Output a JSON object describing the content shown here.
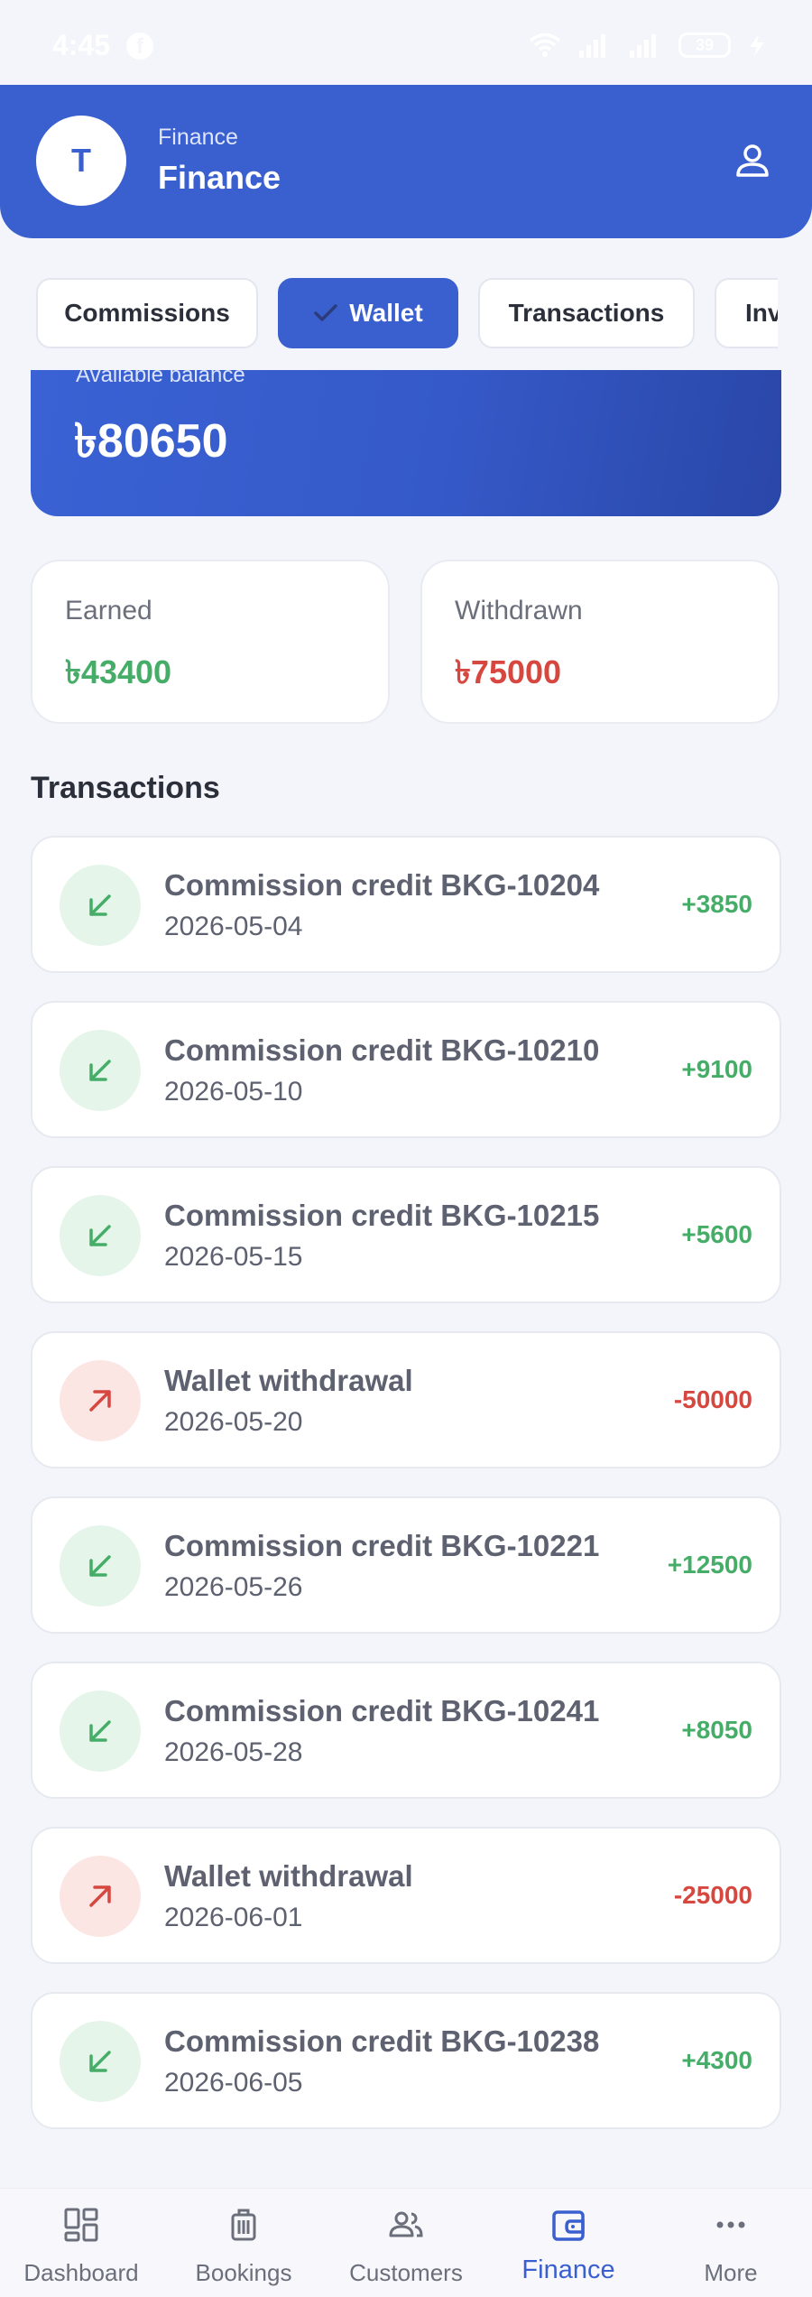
{
  "status_bar": {
    "time": "4:45",
    "battery": "39"
  },
  "header": {
    "avatar_letter": "T",
    "subtitle": "Finance",
    "title": "Finance"
  },
  "tabs": [
    {
      "label": "Commissions"
    },
    {
      "label": "Wallet",
      "active": true
    },
    {
      "label": "Transactions"
    },
    {
      "label": "Inv"
    }
  ],
  "balance": {
    "label": "Available balance",
    "value": "৳80650"
  },
  "stats": {
    "earned": {
      "label": "Earned",
      "value": "৳43400"
    },
    "withdrawn": {
      "label": "Withdrawn",
      "value": "৳75000"
    }
  },
  "transactions_title": "Transactions",
  "transactions": [
    {
      "title": "Commission credit BKG-10204",
      "date": "2026-05-04",
      "amount": "+3850",
      "direction": "in",
      "icon": "arrow-down-left-icon"
    },
    {
      "title": "Commission credit BKG-10210",
      "date": "2026-05-10",
      "amount": "+9100",
      "direction": "in",
      "icon": "arrow-down-left-icon"
    },
    {
      "title": "Commission credit BKG-10215",
      "date": "2026-05-15",
      "amount": "+5600",
      "direction": "in",
      "icon": "arrow-down-left-icon"
    },
    {
      "title": "Wallet withdrawal",
      "date": "2026-05-20",
      "amount": "-50000",
      "direction": "out",
      "icon": "arrow-up-right-icon"
    },
    {
      "title": "Commission credit BKG-10221",
      "date": "2026-05-26",
      "amount": "+12500",
      "direction": "in",
      "icon": "arrow-down-left-icon"
    },
    {
      "title": "Commission credit BKG-10241",
      "date": "2026-05-28",
      "amount": "+8050",
      "direction": "in",
      "icon": "arrow-down-left-icon"
    },
    {
      "title": "Wallet withdrawal",
      "date": "2026-06-01",
      "amount": "-25000",
      "direction": "out",
      "icon": "arrow-up-right-icon"
    },
    {
      "title": "Commission credit BKG-10238",
      "date": "2026-06-05",
      "amount": "+4300",
      "direction": "in",
      "icon": "arrow-down-left-icon"
    }
  ],
  "bottom_nav": [
    {
      "label": "Dashboard",
      "icon": "dashboard-icon"
    },
    {
      "label": "Bookings",
      "icon": "luggage-icon"
    },
    {
      "label": "Customers",
      "icon": "people-icon"
    },
    {
      "label": "Finance",
      "icon": "wallet-icon",
      "active": true
    },
    {
      "label": "More",
      "icon": "more-dots-icon"
    }
  ],
  "colors": {
    "primary": "#3a5fcf",
    "credit": "#46ad68",
    "debit": "#d6473f",
    "background": "#f4f5fa"
  }
}
